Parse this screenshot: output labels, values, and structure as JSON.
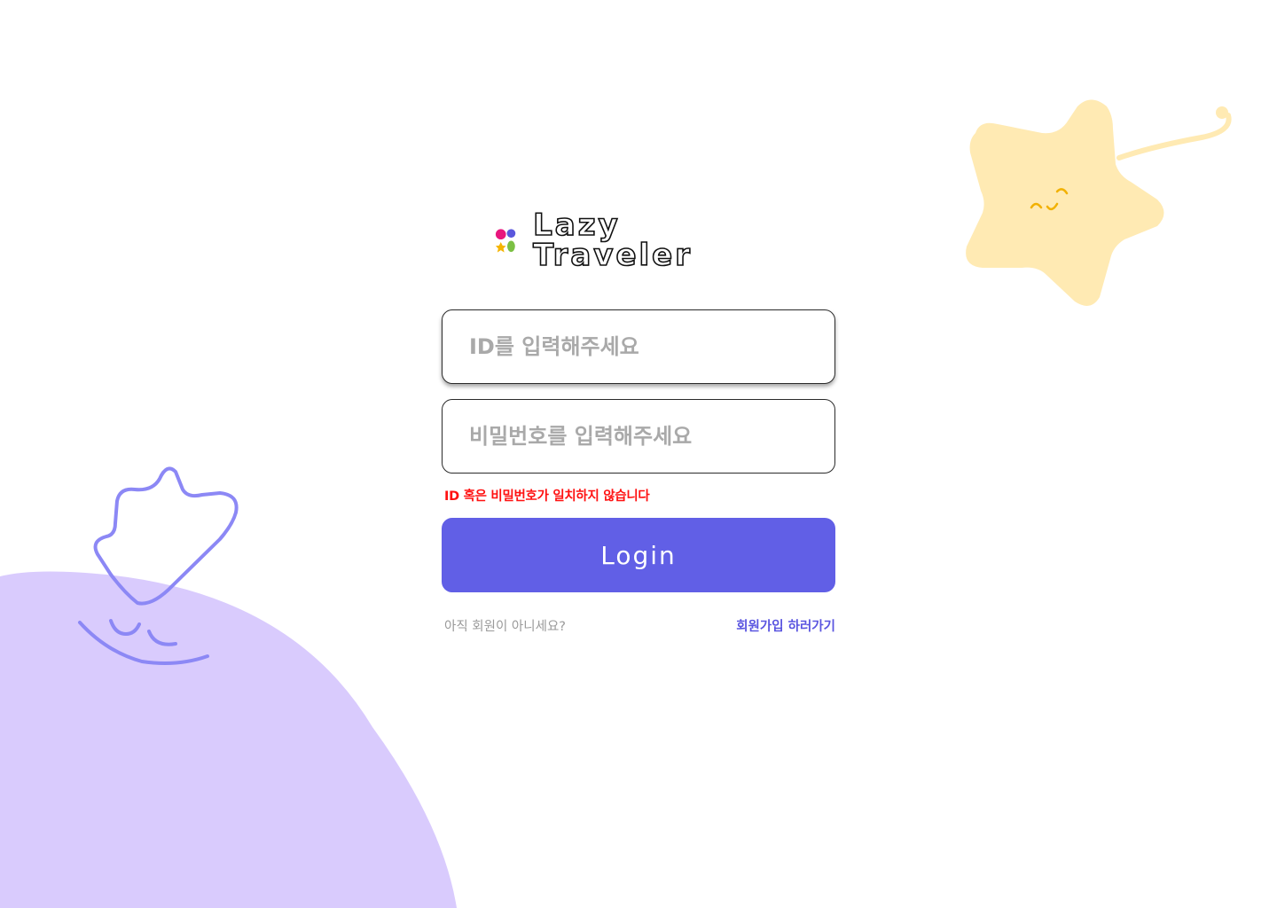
{
  "brand": {
    "title": "Lazy Traveler",
    "logo_colors": [
      "#e8177e",
      "#5b57dd",
      "#f5b400",
      "#7bc043"
    ]
  },
  "form": {
    "id_placeholder": "ID를 입력해주세요",
    "password_placeholder": "비밀번호를 입력해주세요",
    "error_message": "ID 혹은 비밀번호가 일치하지 않습니다",
    "login_label": "Login"
  },
  "signup": {
    "question": "아직 회원이 아니세요?",
    "link_label": "회원가입 하러가기"
  },
  "colors": {
    "accent": "#615fe6",
    "error": "#ff1111",
    "blob": "#d9cbfd",
    "star": "#ffeab3",
    "ghost_outline": "#8c88f5"
  }
}
